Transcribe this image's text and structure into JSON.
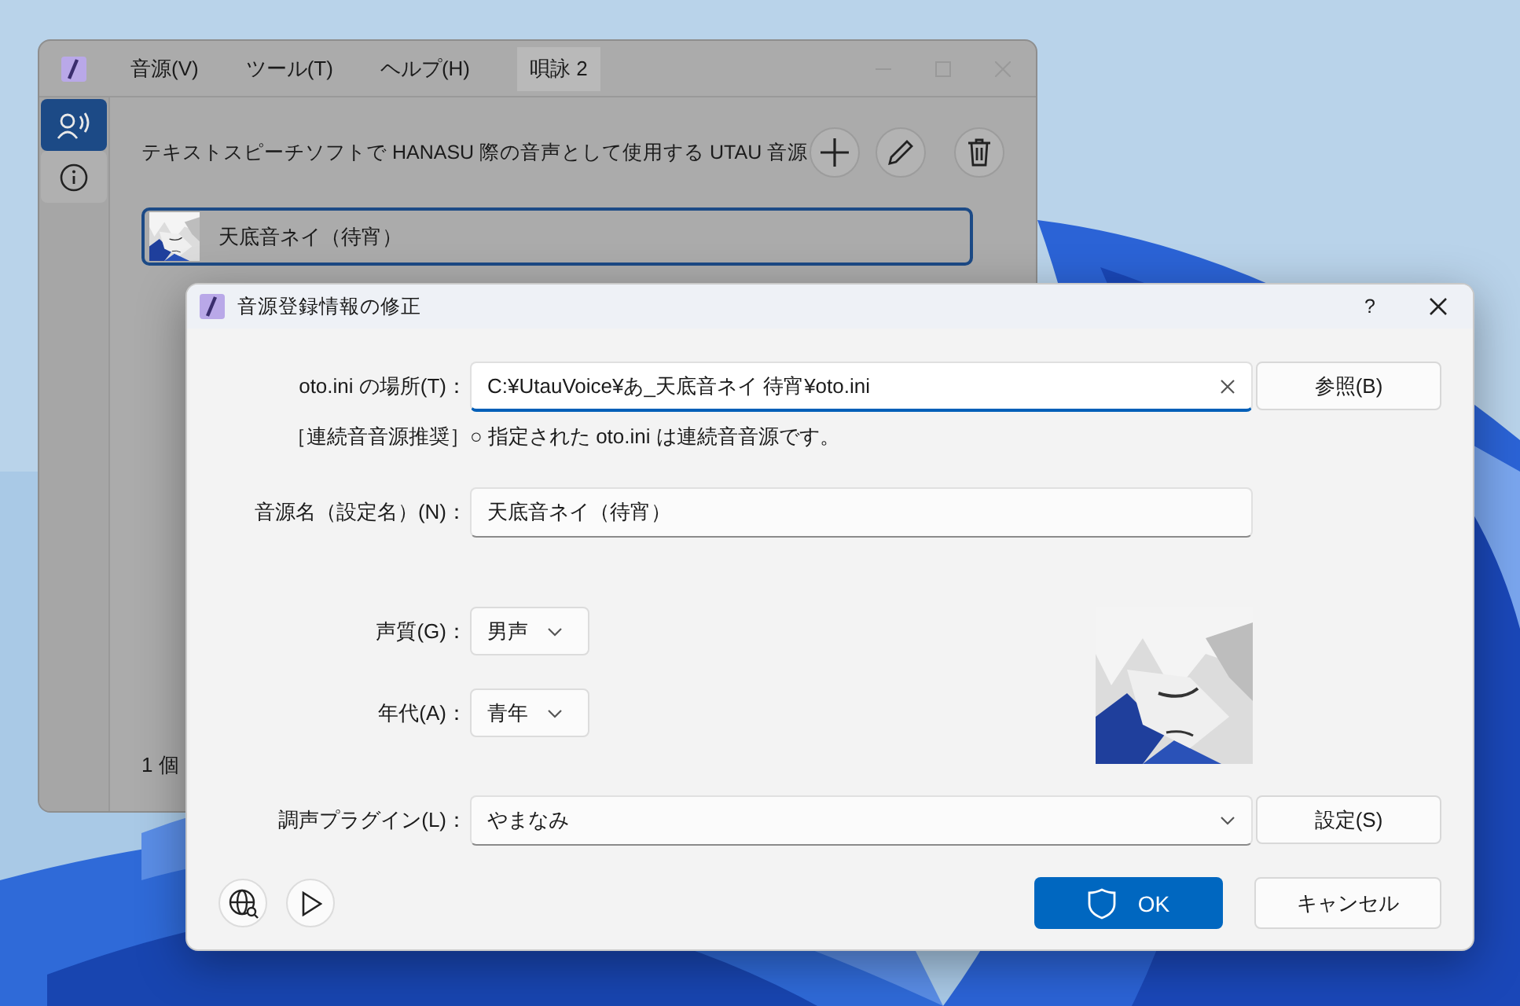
{
  "main_window": {
    "menu": [
      "音源(V)",
      "ツール(T)",
      "ヘルプ(H)"
    ],
    "tab": {
      "label": "唄詠 2",
      "selected": true
    },
    "sidebar": [
      {
        "kind": "voice",
        "selected": true
      },
      {
        "kind": "info",
        "selected": false
      }
    ],
    "description": "テキストスピーチソフトで HANASU 際の音声として使用する UTAU 音源",
    "voices": [
      {
        "name": "天底音ネイ（待宵）",
        "selected": true
      }
    ],
    "status": "1 個"
  },
  "dialog": {
    "title": "音源登録情報の修正",
    "help": "?",
    "location": {
      "label": "oto.ini の場所(T)：",
      "value": "C:¥UtauVoice¥あ_天底音ネイ 待宵¥oto.ini",
      "button": "参照(B)"
    },
    "recommend": {
      "label": "［連続音音源推奨］",
      "note": "○ 指定された oto.ini は連続音音源です。"
    },
    "name": {
      "label": "音源名（設定名）(N)：",
      "value": "天底音ネイ（待宵）"
    },
    "selects": [
      {
        "label": "声質(G)：",
        "value": "男声"
      },
      {
        "label": "年代(A)：",
        "value": "青年"
      }
    ],
    "plugin": {
      "label": "調声プラグイン(L)：",
      "value": "やまなみ",
      "button": "設定(S)"
    },
    "ok": "OK",
    "cancel": "キャンセル"
  }
}
